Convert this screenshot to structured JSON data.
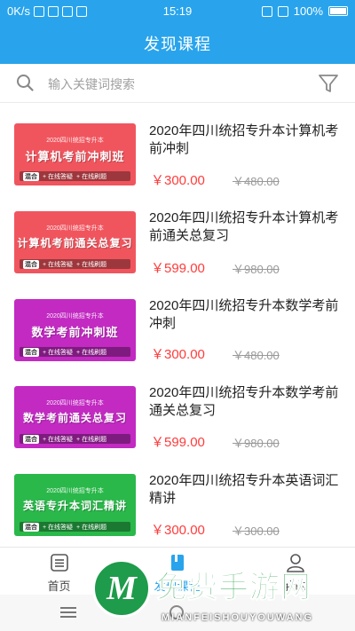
{
  "status_bar": {
    "network": "0K/s",
    "time": "15:19",
    "battery": "100%"
  },
  "header": {
    "title": "发现课程"
  },
  "search": {
    "placeholder": "输入关键词搜索"
  },
  "courses": [
    {
      "title": "2020年四川统招专升本计算机考前冲刺",
      "price": "￥300.00",
      "original_price": "￥480.00",
      "thumb_top": "2020四川统招专升本",
      "thumb_main": "计算机考前冲刺班",
      "thumb_tag": "混合",
      "thumb_extra_1": "+ 在线答疑",
      "thumb_extra_2": "+ 在线刷题",
      "thumb_color": "#f0555e"
    },
    {
      "title": "2020年四川统招专升本计算机考前通关总复习",
      "price": "￥599.00",
      "original_price": "￥980.00",
      "thumb_top": "2020四川统招专升本",
      "thumb_main": "计算机考前通关总复习",
      "thumb_tag": "混合",
      "thumb_extra_1": "+ 在线答疑",
      "thumb_extra_2": "+ 在线刷题",
      "thumb_color": "#f0555e"
    },
    {
      "title": "2020年四川统招专升本数学考前冲刺",
      "price": "￥300.00",
      "original_price": "￥480.00",
      "thumb_top": "2020四川统招专升本",
      "thumb_main": "数学考前冲刺班",
      "thumb_tag": "混合",
      "thumb_extra_1": "+ 在线答疑",
      "thumb_extra_2": "+ 在线刷题",
      "thumb_color": "#c22ac2"
    },
    {
      "title": "2020年四川统招专升本数学考前通关总复习",
      "price": "￥599.00",
      "original_price": "￥980.00",
      "thumb_top": "2020四川统招专升本",
      "thumb_main": "数学考前通关总复习",
      "thumb_tag": "混合",
      "thumb_extra_1": "+ 在线答疑",
      "thumb_extra_2": "+ 在线刷题",
      "thumb_color": "#c22ac2"
    },
    {
      "title": "2020年四川统招专升本英语词汇精讲",
      "price": "￥300.00",
      "original_price": "￥300.00",
      "thumb_top": "2020四川统招专升本",
      "thumb_main": "英语专升本词汇精讲",
      "thumb_tag": "混合",
      "thumb_extra_1": "+ 在线答疑",
      "thumb_extra_2": "+ 在线刷题",
      "thumb_color": "#2ab84a"
    }
  ],
  "tabbar": {
    "home": "首页",
    "discover": "发现课程",
    "mine": "我的"
  },
  "colors": {
    "accent": "#29a4ec",
    "price": "#ff3b3b"
  },
  "watermark": {
    "text": "免费手游网",
    "sub": "MIANFEISHOUYOUWANG",
    "logo": "M"
  }
}
